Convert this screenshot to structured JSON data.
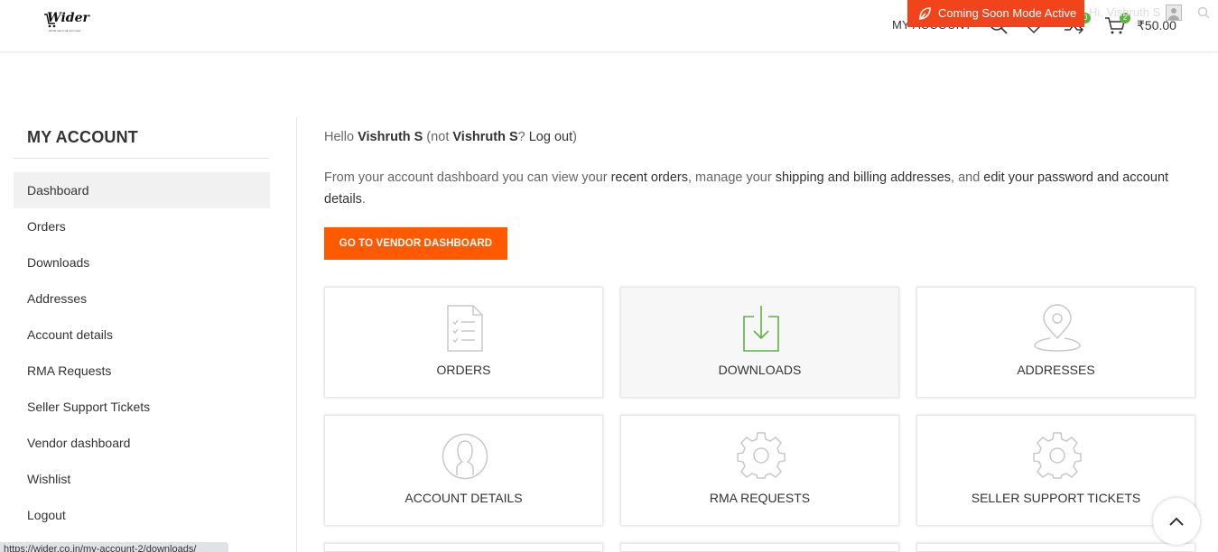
{
  "brand": {
    "name": "Wider",
    "tagline": "All the cart in all your need"
  },
  "admin_bar": {
    "coming_soon": "Coming Soon Mode Active",
    "user": "Hi, Vishruth S"
  },
  "header": {
    "account_link": "MY ACCOUNT",
    "compare_count": "0",
    "cart_count": "2",
    "cart_total": "₹50.00",
    "icons": [
      "search-icon",
      "heart-icon",
      "compare-icon",
      "cart-icon"
    ]
  },
  "sidebar": {
    "title": "MY ACCOUNT",
    "items": [
      {
        "label": "Dashboard",
        "active": true
      },
      {
        "label": "Orders"
      },
      {
        "label": "Downloads"
      },
      {
        "label": "Addresses"
      },
      {
        "label": "Account details"
      },
      {
        "label": "RMA Requests"
      },
      {
        "label": "Seller Support Tickets"
      },
      {
        "label": "Vendor dashboard"
      },
      {
        "label": "Wishlist"
      },
      {
        "label": "Logout"
      }
    ]
  },
  "main": {
    "hello_prefix": "Hello ",
    "user_name": "Vishruth S",
    "hello_mid": " (not ",
    "user_name2": "Vishruth S",
    "hello_q": "? ",
    "logout_link": "Log out",
    "hello_end": ")",
    "intro_1": "From your account dashboard you can view your ",
    "recent_orders_link": "recent orders",
    "intro_2": ", manage your ",
    "addresses_link": "shipping and billing addresses",
    "intro_3": ", and ",
    "account_link": "edit your password and account details",
    "intro_4": ".",
    "vendor_button": "GO TO VENDOR DASHBOARD",
    "tiles": [
      {
        "label": "Orders",
        "icon": "orders-document-icon"
      },
      {
        "label": "Downloads",
        "icon": "download-icon",
        "accent": "#5ab53e"
      },
      {
        "label": "Addresses",
        "icon": "map-pin-icon"
      },
      {
        "label": "Account details",
        "icon": "user-circle-icon"
      },
      {
        "label": "RMA Requests",
        "icon": "gear-icon"
      },
      {
        "label": "Seller Support Tickets",
        "icon": "gear-icon"
      }
    ]
  },
  "status_bar": {
    "url": "https://wider.co.in/my-account-2/downloads/"
  },
  "colors": {
    "accent_orange": "#ff5a00",
    "admin_red": "#f1441b",
    "badge_green": "#5ab53e"
  }
}
